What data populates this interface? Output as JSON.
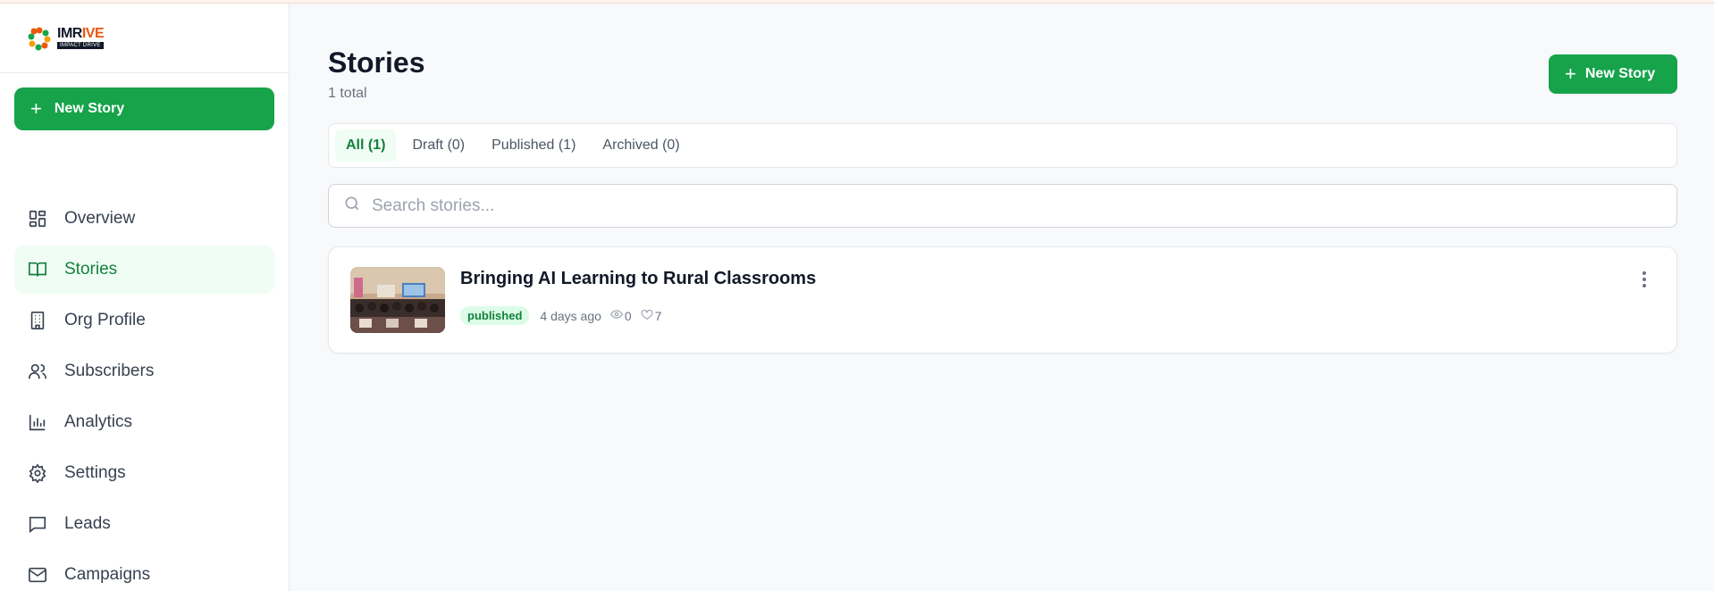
{
  "brand": {
    "name_main": "IMRIVE",
    "name_prefix": "IMR",
    "name_o": "I",
    "name_suffix": "VE",
    "tagline": "IMPACT DRIVE"
  },
  "sidebar": {
    "new_story_label": "New Story",
    "items": [
      {
        "label": "Overview",
        "icon": "layout-icon",
        "active": false
      },
      {
        "label": "Stories",
        "icon": "book-open-icon",
        "active": true
      },
      {
        "label": "Org Profile",
        "icon": "building-icon",
        "active": false
      },
      {
        "label": "Subscribers",
        "icon": "users-icon",
        "active": false
      },
      {
        "label": "Analytics",
        "icon": "bar-chart-icon",
        "active": false
      },
      {
        "label": "Settings",
        "icon": "gear-icon",
        "active": false
      },
      {
        "label": "Leads",
        "icon": "message-icon",
        "active": false
      },
      {
        "label": "Campaigns",
        "icon": "mail-icon",
        "active": false
      }
    ]
  },
  "page": {
    "title": "Stories",
    "subtitle": "1 total",
    "new_story_label": "New Story"
  },
  "tabs": [
    {
      "label": "All (1)",
      "active": true
    },
    {
      "label": "Draft (0)",
      "active": false
    },
    {
      "label": "Published (1)",
      "active": false
    },
    {
      "label": "Archived (0)",
      "active": false
    }
  ],
  "search": {
    "placeholder": "Search stories...",
    "value": ""
  },
  "stories": [
    {
      "title": "Bringing AI Learning to Rural Classrooms",
      "status": "published",
      "time": "4 days ago",
      "views": "0",
      "likes": "7"
    }
  ],
  "colors": {
    "accent": "#16a34a",
    "accent_light": "#f0fdf4",
    "badge_bg": "#dcfce7"
  }
}
